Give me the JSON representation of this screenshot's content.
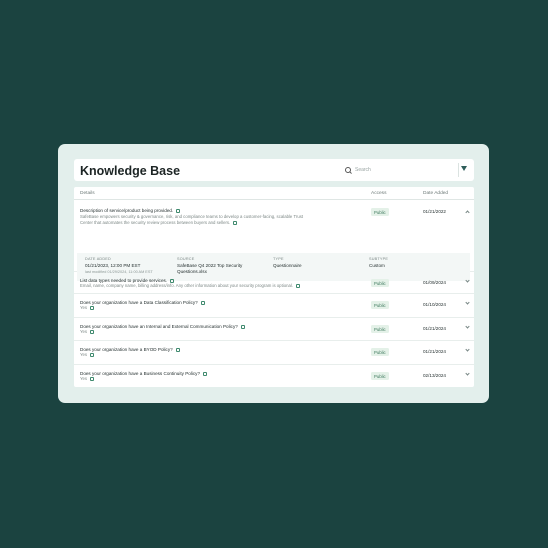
{
  "header": {
    "title": "Knowledge Base",
    "search_placeholder": "Search"
  },
  "table": {
    "columns": {
      "details": "Details",
      "access": "Access",
      "date_added": "Date Added"
    },
    "expanded": {
      "question": "Description of service/product being provided.",
      "answer": "SafeBase empowers security & governance, risk, and compliance teams to develop a customer-facing, scalable Trust Center that automates the security review process between buyers and sellers.",
      "access": "Public",
      "date": "01/21/2022",
      "detail": {
        "date_added_label": "DATE ADDED",
        "date_added_value": "01/21/2023, 12:00 PM EST",
        "last_modified": "last modified 01/29/2024, 11:00 AM EST",
        "source_label": "SOURCE",
        "source_value": "SafeBase Q4 2022 Top Security Questions.xlsx",
        "type_label": "TYPE",
        "type_value": "Questionnaire",
        "subtype_label": "SUBTYPE",
        "subtype_value": "Custom"
      }
    },
    "rows": [
      {
        "question": "List data types needed to provide services.",
        "answer": "Email, name, company name, billing address/info. Any other information about your security program is optional.",
        "access": "Public",
        "date": "01/09/2024"
      },
      {
        "question": "Does your organization have a Data Classification Policy?",
        "answer": "Yes",
        "access": "Public",
        "date": "01/10/2024"
      },
      {
        "question": "Does your organization have an Internal and External Communication Policy?",
        "answer": "Yes",
        "access": "Public",
        "date": "01/21/2024"
      },
      {
        "question": "Does your organization have a BYOD Policy?",
        "answer": "Yes",
        "access": "Public",
        "date": "01/21/2024"
      },
      {
        "question": "Does your organization have a Business Continuity Policy?",
        "answer": "Yes",
        "access": "Public",
        "date": "02/13/2024"
      }
    ]
  },
  "icons": {
    "search": "search-icon",
    "filter": "filter-icon",
    "copy": "copy-icon",
    "chevron": "chevron-icon"
  }
}
